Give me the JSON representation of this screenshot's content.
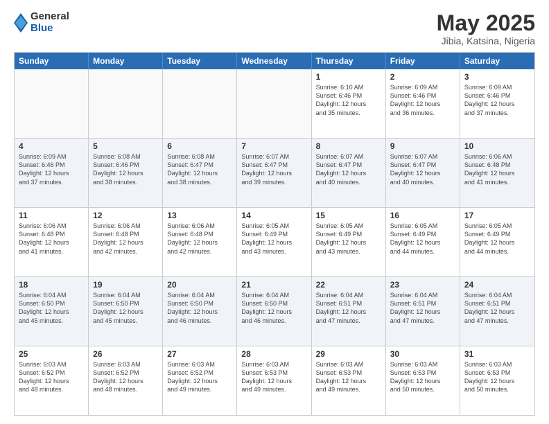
{
  "logo": {
    "general": "General",
    "blue": "Blue"
  },
  "title": "May 2025",
  "subtitle": "Jibia, Katsina, Nigeria",
  "header_days": [
    "Sunday",
    "Monday",
    "Tuesday",
    "Wednesday",
    "Thursday",
    "Friday",
    "Saturday"
  ],
  "weeks": [
    [
      {
        "day": "",
        "info": ""
      },
      {
        "day": "",
        "info": ""
      },
      {
        "day": "",
        "info": ""
      },
      {
        "day": "",
        "info": ""
      },
      {
        "day": "1",
        "info": "Sunrise: 6:10 AM\nSunset: 6:46 PM\nDaylight: 12 hours\nand 35 minutes."
      },
      {
        "day": "2",
        "info": "Sunrise: 6:09 AM\nSunset: 6:46 PM\nDaylight: 12 hours\nand 36 minutes."
      },
      {
        "day": "3",
        "info": "Sunrise: 6:09 AM\nSunset: 6:46 PM\nDaylight: 12 hours\nand 37 minutes."
      }
    ],
    [
      {
        "day": "4",
        "info": "Sunrise: 6:09 AM\nSunset: 6:46 PM\nDaylight: 12 hours\nand 37 minutes."
      },
      {
        "day": "5",
        "info": "Sunrise: 6:08 AM\nSunset: 6:46 PM\nDaylight: 12 hours\nand 38 minutes."
      },
      {
        "day": "6",
        "info": "Sunrise: 6:08 AM\nSunset: 6:47 PM\nDaylight: 12 hours\nand 38 minutes."
      },
      {
        "day": "7",
        "info": "Sunrise: 6:07 AM\nSunset: 6:47 PM\nDaylight: 12 hours\nand 39 minutes."
      },
      {
        "day": "8",
        "info": "Sunrise: 6:07 AM\nSunset: 6:47 PM\nDaylight: 12 hours\nand 40 minutes."
      },
      {
        "day": "9",
        "info": "Sunrise: 6:07 AM\nSunset: 6:47 PM\nDaylight: 12 hours\nand 40 minutes."
      },
      {
        "day": "10",
        "info": "Sunrise: 6:06 AM\nSunset: 6:48 PM\nDaylight: 12 hours\nand 41 minutes."
      }
    ],
    [
      {
        "day": "11",
        "info": "Sunrise: 6:06 AM\nSunset: 6:48 PM\nDaylight: 12 hours\nand 41 minutes."
      },
      {
        "day": "12",
        "info": "Sunrise: 6:06 AM\nSunset: 6:48 PM\nDaylight: 12 hours\nand 42 minutes."
      },
      {
        "day": "13",
        "info": "Sunrise: 6:06 AM\nSunset: 6:48 PM\nDaylight: 12 hours\nand 42 minutes."
      },
      {
        "day": "14",
        "info": "Sunrise: 6:05 AM\nSunset: 6:49 PM\nDaylight: 12 hours\nand 43 minutes."
      },
      {
        "day": "15",
        "info": "Sunrise: 6:05 AM\nSunset: 6:49 PM\nDaylight: 12 hours\nand 43 minutes."
      },
      {
        "day": "16",
        "info": "Sunrise: 6:05 AM\nSunset: 6:49 PM\nDaylight: 12 hours\nand 44 minutes."
      },
      {
        "day": "17",
        "info": "Sunrise: 6:05 AM\nSunset: 6:49 PM\nDaylight: 12 hours\nand 44 minutes."
      }
    ],
    [
      {
        "day": "18",
        "info": "Sunrise: 6:04 AM\nSunset: 6:50 PM\nDaylight: 12 hours\nand 45 minutes."
      },
      {
        "day": "19",
        "info": "Sunrise: 6:04 AM\nSunset: 6:50 PM\nDaylight: 12 hours\nand 45 minutes."
      },
      {
        "day": "20",
        "info": "Sunrise: 6:04 AM\nSunset: 6:50 PM\nDaylight: 12 hours\nand 46 minutes."
      },
      {
        "day": "21",
        "info": "Sunrise: 6:04 AM\nSunset: 6:50 PM\nDaylight: 12 hours\nand 46 minutes."
      },
      {
        "day": "22",
        "info": "Sunrise: 6:04 AM\nSunset: 6:51 PM\nDaylight: 12 hours\nand 47 minutes."
      },
      {
        "day": "23",
        "info": "Sunrise: 6:04 AM\nSunset: 6:51 PM\nDaylight: 12 hours\nand 47 minutes."
      },
      {
        "day": "24",
        "info": "Sunrise: 6:04 AM\nSunset: 6:51 PM\nDaylight: 12 hours\nand 47 minutes."
      }
    ],
    [
      {
        "day": "25",
        "info": "Sunrise: 6:03 AM\nSunset: 6:52 PM\nDaylight: 12 hours\nand 48 minutes."
      },
      {
        "day": "26",
        "info": "Sunrise: 6:03 AM\nSunset: 6:52 PM\nDaylight: 12 hours\nand 48 minutes."
      },
      {
        "day": "27",
        "info": "Sunrise: 6:03 AM\nSunset: 6:52 PM\nDaylight: 12 hours\nand 49 minutes."
      },
      {
        "day": "28",
        "info": "Sunrise: 6:03 AM\nSunset: 6:53 PM\nDaylight: 12 hours\nand 49 minutes."
      },
      {
        "day": "29",
        "info": "Sunrise: 6:03 AM\nSunset: 6:53 PM\nDaylight: 12 hours\nand 49 minutes."
      },
      {
        "day": "30",
        "info": "Sunrise: 6:03 AM\nSunset: 6:53 PM\nDaylight: 12 hours\nand 50 minutes."
      },
      {
        "day": "31",
        "info": "Sunrise: 6:03 AM\nSunset: 6:53 PM\nDaylight: 12 hours\nand 50 minutes."
      }
    ]
  ]
}
